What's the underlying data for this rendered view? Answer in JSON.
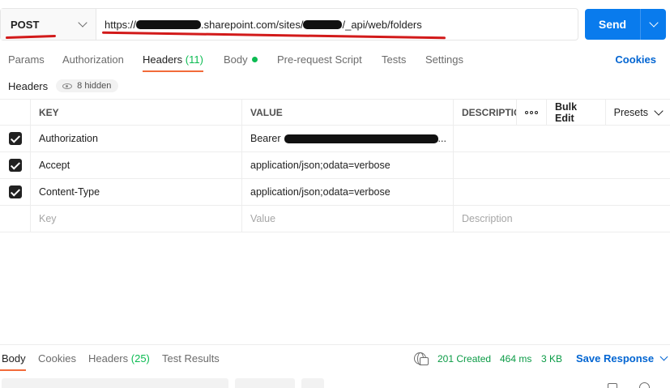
{
  "request": {
    "method": "POST",
    "url": {
      "prefix": "https://",
      "segment_1": ".sharepoint.com/sites/",
      "segment_2": "/_api/web/folders"
    },
    "send_label": "Send"
  },
  "tabs": [
    {
      "label": "Params"
    },
    {
      "label": "Authorization"
    },
    {
      "label": "Headers",
      "count": "(11)"
    },
    {
      "label": "Body"
    },
    {
      "label": "Pre-request Script"
    },
    {
      "label": "Tests"
    },
    {
      "label": "Settings"
    }
  ],
  "cookies_label": "Cookies",
  "headers_section": {
    "title": "Headers",
    "hidden_label": "8 hidden"
  },
  "table": {
    "columns": {
      "key": "KEY",
      "value": "VALUE",
      "description": "DESCRIPTION"
    },
    "bulk_edit": "Bulk Edit",
    "presets": "Presets",
    "rows": [
      {
        "key": "Authorization",
        "value": "Bearer",
        "value_suffix": "..."
      },
      {
        "key": "Accept",
        "value": "application/json;odata=verbose"
      },
      {
        "key": "Content-Type",
        "value": "application/json;odata=verbose"
      }
    ],
    "placeholders": {
      "key": "Key",
      "value": "Value",
      "description": "Description"
    }
  },
  "response": {
    "tabs": [
      {
        "label": "Body"
      },
      {
        "label": "Cookies"
      },
      {
        "label": "Headers",
        "count": "(25)"
      },
      {
        "label": "Test Results"
      }
    ],
    "status": "201 Created",
    "time": "464 ms",
    "size": "3 KB",
    "save_label": "Save Response"
  },
  "colors": {
    "accent": "#097bed",
    "active_tab": "#f26b3a",
    "success": "#0cbb52",
    "link": "#0265d2",
    "annotation": "#d21a1a"
  },
  "icons": [
    "chevron-down-icon",
    "eye-icon",
    "checkbox-checked-icon",
    "more-horizontal-icon",
    "globe-icon"
  ]
}
